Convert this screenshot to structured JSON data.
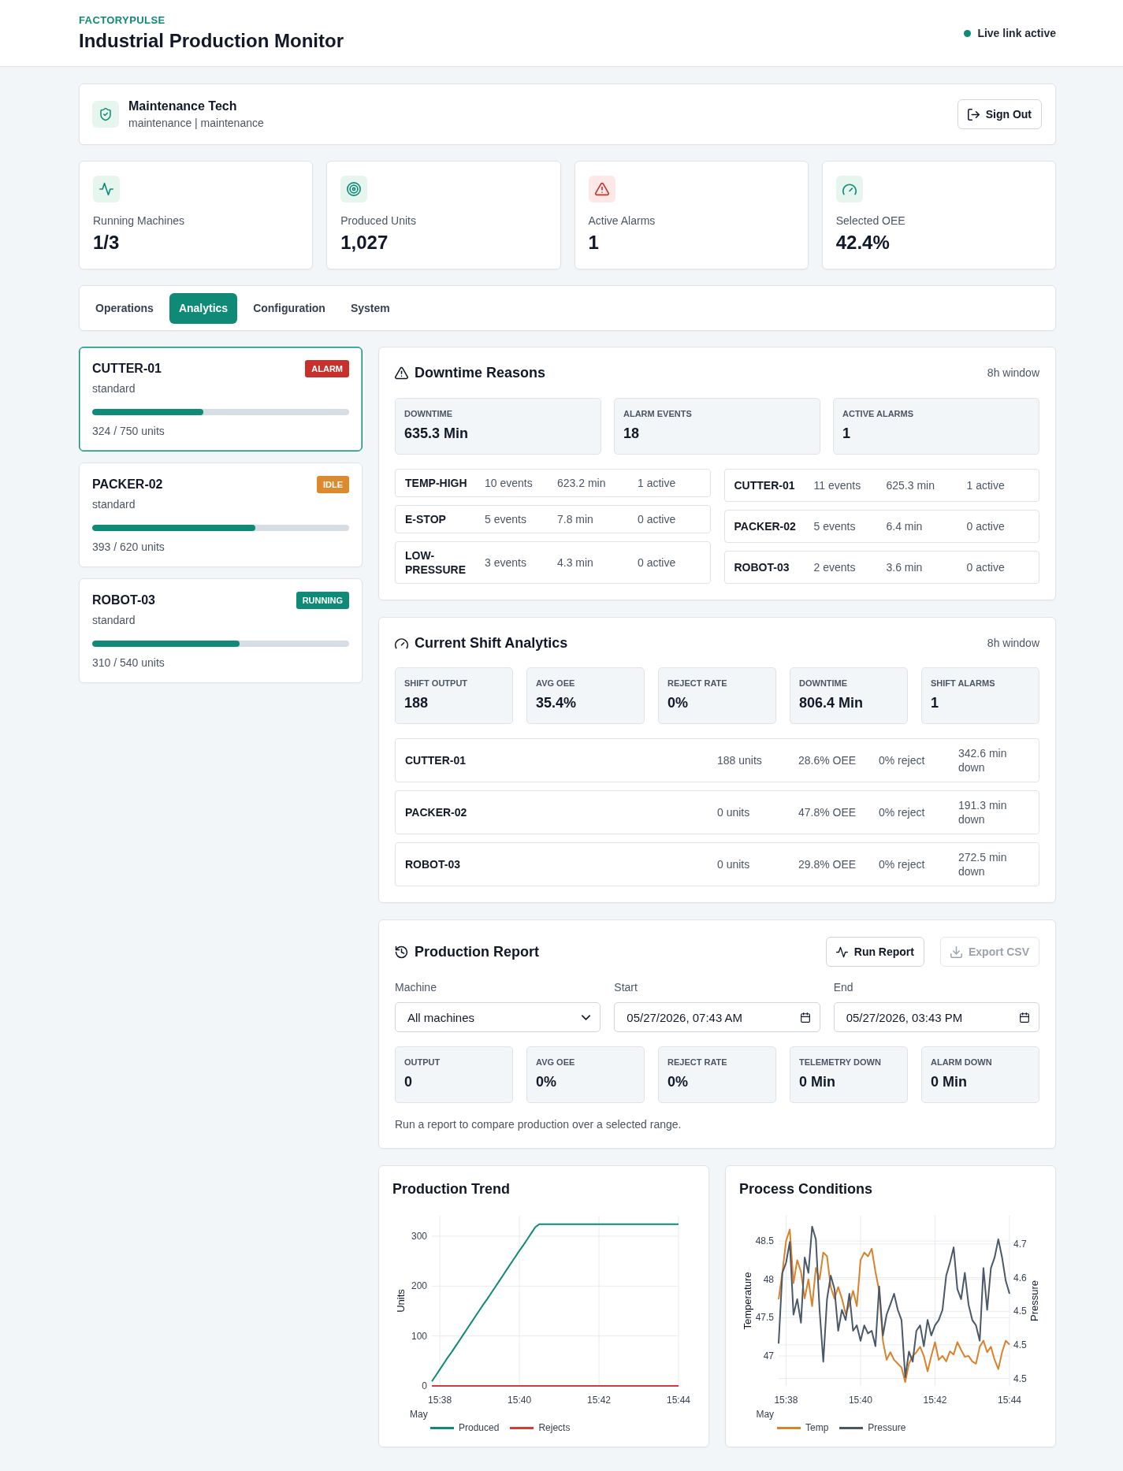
{
  "header": {
    "brand": "FACTORYPULSE",
    "title": "Industrial Production Monitor",
    "link_status": {
      "label": "Live link active",
      "connected": true
    }
  },
  "user": {
    "name": "Maintenance Tech",
    "subtitle": "maintenance | maintenance",
    "sign_out": "Sign Out"
  },
  "stats": [
    {
      "label": "Running Machines",
      "value": "1/3",
      "alert": false
    },
    {
      "label": "Produced Units",
      "value": "1,027",
      "alert": false
    },
    {
      "label": "Active Alarms",
      "value": "1",
      "alert": true
    },
    {
      "label": "Selected OEE",
      "value": "42.4%",
      "alert": false
    }
  ],
  "tabs": [
    {
      "label": "Operations",
      "selected": false
    },
    {
      "label": "Analytics",
      "selected": true
    },
    {
      "label": "Configuration",
      "selected": false
    },
    {
      "label": "System",
      "selected": false
    }
  ],
  "machines": [
    {
      "name": "CUTTER-01",
      "badge": "ALARM",
      "color": "#c8312b",
      "type": "standard",
      "level": 0.432,
      "units": "324 / 750 units",
      "selected": true
    },
    {
      "name": "PACKER-02",
      "badge": "IDLE",
      "color": "#dd8a2f",
      "type": "standard",
      "level": 0.634,
      "units": "393 / 620 units",
      "selected": false
    },
    {
      "name": "ROBOT-03",
      "badge": "RUNNING",
      "color": "#0f8a76",
      "type": "standard",
      "level": 0.574,
      "units": "310 / 540 units",
      "selected": false
    }
  ],
  "downtime": {
    "title": "Downtime Reasons",
    "window": "8h window",
    "summary": [
      {
        "label": "DOWNTIME",
        "value": "635.3 Min"
      },
      {
        "label": "ALARM EVENTS",
        "value": "18"
      },
      {
        "label": "ACTIVE ALARMS",
        "value": "1"
      }
    ],
    "by_reason": [
      {
        "name": "TEMP-HIGH",
        "events": "10 events",
        "minutes": "623.2 min",
        "active": "1 active"
      },
      {
        "name": "E-STOP",
        "events": "5 events",
        "minutes": "7.8 min",
        "active": "0 active"
      },
      {
        "name": "LOW-PRESSURE",
        "events": "3 events",
        "minutes": "4.3 min",
        "active": "0 active"
      }
    ],
    "by_machine": [
      {
        "name": "CUTTER-01",
        "events": "11 events",
        "minutes": "625.3 min",
        "active": "1 active"
      },
      {
        "name": "PACKER-02",
        "events": "5 events",
        "minutes": "6.4 min",
        "active": "0 active"
      },
      {
        "name": "ROBOT-03",
        "events": "2 events",
        "minutes": "3.6 min",
        "active": "0 active"
      }
    ]
  },
  "shift": {
    "title": "Current Shift Analytics",
    "window": "8h window",
    "summary": [
      {
        "label": "SHIFT OUTPUT",
        "value": "188"
      },
      {
        "label": "AVG OEE",
        "value": "35.4%"
      },
      {
        "label": "REJECT RATE",
        "value": "0%"
      },
      {
        "label": "DOWNTIME",
        "value": "806.4 Min"
      },
      {
        "label": "SHIFT ALARMS",
        "value": "1"
      }
    ],
    "machines": [
      {
        "name": "CUTTER-01",
        "units": "188 units",
        "oee": "28.6% OEE",
        "reject": "0% reject",
        "down": "342.6 min down"
      },
      {
        "name": "PACKER-02",
        "units": "0 units",
        "oee": "47.8% OEE",
        "reject": "0% reject",
        "down": "191.3 min down"
      },
      {
        "name": "ROBOT-03",
        "units": "0 units",
        "oee": "29.8% OEE",
        "reject": "0% reject",
        "down": "272.5 min down"
      }
    ]
  },
  "report": {
    "title": "Production Report",
    "buttons": [
      {
        "label": "Run Report",
        "disabled": false
      },
      {
        "label": "Export CSV",
        "disabled": true
      }
    ],
    "fields": [
      {
        "label": "Machine",
        "value": "All machines",
        "kind": "select"
      },
      {
        "label": "Start",
        "value": "05/27/2026, 07:43 AM",
        "kind": "datetime"
      },
      {
        "label": "End",
        "value": "05/27/2026, 03:43 PM",
        "kind": "datetime"
      }
    ],
    "summary": [
      {
        "label": "OUTPUT",
        "value": "0"
      },
      {
        "label": "AVG OEE",
        "value": "0%"
      },
      {
        "label": "REJECT RATE",
        "value": "0%"
      },
      {
        "label": "TELEMETRY DOWN",
        "value": "0 Min"
      },
      {
        "label": "ALARM DOWN",
        "value": "0 Min"
      }
    ],
    "note": "Run a report to compare production over a selected range."
  },
  "charts": [
    {
      "x_date_label": "May",
      "chart_data": {
        "type": "line",
        "title": "Production Trend",
        "ylabel": "Units",
        "categories": [
          null,
          null,
          "15:38",
          null,
          null,
          null,
          null,
          null,
          null,
          null,
          null,
          null,
          null,
          null,
          null,
          null,
          null,
          null,
          null,
          null,
          null,
          null,
          "15:40",
          null,
          null,
          null,
          null,
          null,
          null,
          null,
          null,
          null,
          null,
          null,
          null,
          null,
          null,
          null,
          null,
          null,
          null,
          null,
          "15:42",
          null,
          null,
          null,
          null,
          null,
          null,
          null,
          null,
          null,
          null,
          null,
          null,
          null,
          null,
          null,
          null,
          null,
          null,
          null,
          "15:44"
        ],
        "series": [
          {
            "name": "Produced",
            "color": "#0f8a76",
            "values": [
              9,
              21,
              33,
              45,
              57,
              68,
              80,
              92,
              104,
              116,
              128,
              140,
              152,
              164,
              175,
              187,
              199,
              211,
              223,
              235,
              247,
              259,
              271,
              282,
              294,
              306,
              318,
              324,
              324,
              324,
              324,
              324,
              324,
              324,
              324,
              324,
              324,
              324,
              324,
              324,
              324,
              324,
              324,
              324,
              324,
              324,
              324,
              324,
              324,
              324,
              324,
              324,
              324,
              324,
              324,
              324,
              324,
              324,
              324,
              324,
              324,
              324,
              324
            ]
          },
          {
            "name": "Rejects",
            "color": "#d63a3a",
            "values": [
              0,
              0,
              0,
              0,
              0,
              0,
              0,
              0,
              0,
              0,
              0,
              0,
              0,
              0,
              0,
              0,
              0,
              0,
              0,
              0,
              0,
              0,
              0,
              0,
              0,
              0,
              0,
              0,
              0,
              0,
              0,
              0,
              0,
              0,
              0,
              0,
              0,
              0,
              0,
              0,
              0,
              0,
              0,
              0,
              0,
              0,
              0,
              0,
              0,
              0,
              0,
              0,
              0,
              0,
              0,
              0,
              0,
              0,
              0,
              0,
              0,
              0,
              0
            ]
          }
        ],
        "ylim": [
          0,
          341
        ],
        "yticks": [
          0,
          100,
          200,
          300
        ],
        "grid": true,
        "legend": "bottom"
      }
    },
    {
      "x_date_label": "May",
      "chart_data": {
        "type": "line",
        "title": "Process Conditions",
        "ylabel": "Temperature",
        "y2label": "Pressure",
        "categories": [
          null,
          null,
          "15:38",
          null,
          null,
          null,
          null,
          null,
          null,
          null,
          null,
          null,
          null,
          null,
          null,
          null,
          null,
          null,
          null,
          null,
          null,
          null,
          "15:40",
          null,
          null,
          null,
          null,
          null,
          null,
          null,
          null,
          null,
          null,
          null,
          null,
          null,
          null,
          null,
          null,
          null,
          null,
          null,
          "15:42",
          null,
          null,
          null,
          null,
          null,
          null,
          null,
          null,
          null,
          null,
          null,
          null,
          null,
          null,
          null,
          null,
          null,
          null,
          null,
          "15:44"
        ],
        "series": [
          {
            "name": "Temp",
            "color": "#d9822b",
            "values": [
              47.74,
              48.08,
              48.5,
              48.65,
              47.95,
              48.25,
              48.1,
              47.75,
              48.0,
              47.65,
              48.15,
              48.0,
              48.35,
              48.3,
              47.9,
              47.75,
              47.9,
              47.75,
              47.55,
              47.67,
              47.85,
              47.65,
              48.25,
              48.35,
              48.3,
              48.4,
              48.1,
              47.85,
              47.2,
              46.95,
              47.05,
              46.95,
              46.9,
              46.85,
              46.66,
              46.9,
              47.0,
              47.05,
              47.12,
              47.0,
              46.8,
              47.0,
              47.18,
              46.95,
              47.0,
              46.93,
              47.06,
              47.02,
              47.18,
              47.08,
              46.99,
              47.0,
              46.93,
              46.9,
              47.12,
              47.2,
              47.05,
              47.12,
              46.95,
              46.83,
              47.05,
              47.2,
              47.15
            ]
          },
          {
            "name": "Pressure",
            "color": "#4a5868",
            "axis": "y2",
            "values": [
              4.502,
              4.607,
              4.622,
              4.653,
              4.545,
              4.568,
              4.533,
              4.63,
              4.607,
              4.676,
              4.657,
              4.552,
              4.475,
              4.568,
              4.603,
              4.583,
              4.521,
              4.552,
              4.537,
              4.576,
              4.521,
              4.529,
              4.506,
              4.529,
              4.517,
              4.521,
              4.498,
              4.587,
              4.514,
              4.545,
              4.56,
              4.576,
              4.552,
              4.537,
              4.452,
              4.49,
              4.475,
              4.521,
              4.529,
              4.498,
              4.537,
              4.514,
              4.529,
              4.537,
              4.552,
              4.603,
              4.622,
              4.645,
              4.583,
              4.568,
              4.607,
              4.56,
              4.537,
              4.529,
              4.506,
              4.614,
              4.552,
              4.614,
              4.63,
              4.657,
              4.63,
              4.595,
              4.576
            ]
          }
        ],
        "ylim": [
          46.61,
          48.83
        ],
        "y2lim": [
          4.439,
          4.692
        ],
        "yticks": [
          47,
          47.5,
          48,
          48.5
        ],
        "y2ticks": [
          {
            "value": 4.65,
            "label": "4.7"
          },
          {
            "value": 4.6,
            "label": "4.6"
          },
          {
            "value": 4.55,
            "label": "4.5"
          },
          {
            "value": 4.5,
            "label": "4.5"
          },
          {
            "value": 4.45,
            "label": "4.5"
          }
        ],
        "grid": true,
        "legend": "bottom"
      }
    }
  ]
}
